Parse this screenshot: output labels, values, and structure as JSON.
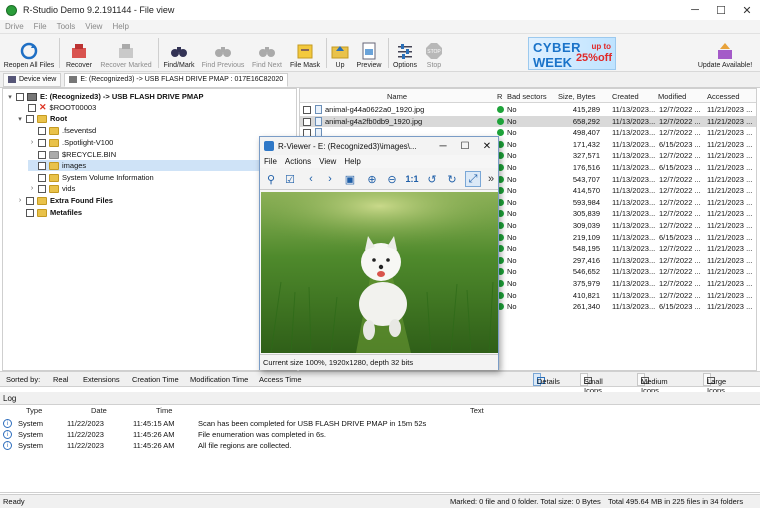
{
  "window": {
    "title": "R-Studio Demo 9.2.191144 - File view"
  },
  "menu": [
    "Drive",
    "File",
    "Tools",
    "View",
    "Help"
  ],
  "toolbar": {
    "reopen": "Reopen All Files",
    "recover": "Recover",
    "recover_marked": "Recover Marked",
    "find_mark": "Find/Mark",
    "find_previous": "Find Previous",
    "find_next": "Find Next",
    "file_mask": "File Mask",
    "up": "Up",
    "preview": "Preview",
    "options": "Options",
    "stop": "Stop",
    "update": "Update Available!"
  },
  "banner": {
    "line1": "CYBER",
    "line2": "WEEK",
    "up_to": "up to",
    "off": "25%off"
  },
  "tabs": {
    "device_view": "Device view",
    "path": "E: (Recognized3) -> USB FLASH DRIVE PMAP : 017E16C82020"
  },
  "tree": [
    {
      "label": "E: (Recognized3) -> USB FLASH DRIVE PMAP"
    },
    {
      "label": "$ROOT00003"
    },
    {
      "label": "Root"
    },
    {
      "label": ".fseventsd"
    },
    {
      "label": ".Spotlight-V100"
    },
    {
      "label": "$RECYCLE.BIN"
    },
    {
      "label": "images"
    },
    {
      "label": "System Volume Information"
    },
    {
      "label": "vids"
    },
    {
      "label": "Extra Found Files"
    },
    {
      "label": "Metafiles"
    }
  ],
  "file_headers": {
    "name": "Name",
    "r": "R",
    "bad": "Bad sectors",
    "size": "Size, Bytes",
    "created": "Created",
    "modified": "Modified",
    "accessed": "Accessed"
  },
  "files": [
    {
      "name": "animal-g44a0622a0_1920.jpg",
      "bad": "No",
      "size": "415,289",
      "created": "11/13/2023...",
      "modified": "12/7/2022 ...",
      "accessed": "11/21/2023 ..."
    },
    {
      "name": "animal-g4a2fb0db9_1920.jpg",
      "bad": "No",
      "size": "658,292",
      "created": "11/13/2023...",
      "modified": "12/7/2022 ...",
      "accessed": "11/21/2023 ..."
    },
    {
      "name": "",
      "bad": "No",
      "size": "498,407",
      "created": "11/13/2023...",
      "modified": "12/7/2022 ...",
      "accessed": "11/21/2023 ..."
    },
    {
      "name": "",
      "bad": "No",
      "size": "171,432",
      "created": "11/13/2023...",
      "modified": "6/15/2023 ...",
      "accessed": "11/21/2023 ..."
    },
    {
      "name": "",
      "bad": "No",
      "size": "327,571",
      "created": "11/13/2023...",
      "modified": "12/7/2022 ...",
      "accessed": "11/21/2023 ..."
    },
    {
      "name": "",
      "bad": "No",
      "size": "176,516",
      "created": "11/13/2023...",
      "modified": "6/15/2023 ...",
      "accessed": "11/21/2023 ..."
    },
    {
      "name": "",
      "bad": "No",
      "size": "543,707",
      "created": "11/13/2023...",
      "modified": "12/7/2022 ...",
      "accessed": "11/21/2023 ..."
    },
    {
      "name": "",
      "bad": "No",
      "size": "414,570",
      "created": "11/13/2023...",
      "modified": "12/7/2022 ...",
      "accessed": "11/21/2023 ..."
    },
    {
      "name": "",
      "bad": "No",
      "size": "593,984",
      "created": "11/13/2023...",
      "modified": "12/7/2022 ...",
      "accessed": "11/21/2023 ..."
    },
    {
      "name": "",
      "bad": "No",
      "size": "305,839",
      "created": "11/13/2023...",
      "modified": "12/7/2022 ...",
      "accessed": "11/21/2023 ..."
    },
    {
      "name": "",
      "bad": "No",
      "size": "309,039",
      "created": "11/13/2023...",
      "modified": "12/7/2022 ...",
      "accessed": "11/21/2023 ..."
    },
    {
      "name": "",
      "bad": "No",
      "size": "219,109",
      "created": "11/13/2023...",
      "modified": "6/15/2023 ...",
      "accessed": "11/21/2023 ..."
    },
    {
      "name": "",
      "bad": "No",
      "size": "548,195",
      "created": "11/13/2023...",
      "modified": "12/7/2022 ...",
      "accessed": "11/21/2023 ..."
    },
    {
      "name": "",
      "bad": "No",
      "size": "297,416",
      "created": "11/13/2023...",
      "modified": "12/7/2022 ...",
      "accessed": "11/21/2023 ..."
    },
    {
      "name": "",
      "bad": "No",
      "size": "546,652",
      "created": "11/13/2023...",
      "modified": "12/7/2022 ...",
      "accessed": "11/21/2023 ..."
    },
    {
      "name": "",
      "bad": "No",
      "size": "375,979",
      "created": "11/13/2023...",
      "modified": "12/7/2022 ...",
      "accessed": "11/21/2023 ..."
    },
    {
      "name": "",
      "bad": "No",
      "size": "410,821",
      "created": "11/13/2023...",
      "modified": "12/7/2022 ...",
      "accessed": "11/21/2023 ..."
    },
    {
      "name": "",
      "bad": "No",
      "size": "261,340",
      "created": "11/13/2023...",
      "modified": "6/15/2023 ...",
      "accessed": "11/21/2023 ..."
    }
  ],
  "sortbar": {
    "label": "Sorted by:",
    "items": [
      "Real",
      "Extensions",
      "Creation Time",
      "Modification Time",
      "Access Time"
    ]
  },
  "views": [
    "Details",
    "Small Icons",
    "Medium Icons",
    "Large Icons"
  ],
  "log": {
    "title": "Log",
    "headers": {
      "type": "Type",
      "date": "Date",
      "time": "Time",
      "text": "Text"
    },
    "rows": [
      {
        "type": "System",
        "date": "11/22/2023",
        "time": "11:45:15 AM",
        "text": "Scan has been completed for USB FLASH DRIVE PMAP in 15m 52s"
      },
      {
        "type": "System",
        "date": "11/22/2023",
        "time": "11:45:26 AM",
        "text": "File enumeration was completed in 6s."
      },
      {
        "type": "System",
        "date": "11/22/2023",
        "time": "11:45:26 AM",
        "text": "All file regions are collected."
      }
    ]
  },
  "status": {
    "left": "Ready",
    "marked": "Marked: 0 file and 0 folder. Total size: 0 Bytes",
    "total": "Total 495.64 MB in 225 files in 34 folders"
  },
  "viewer": {
    "title": "R-Viewer - E: (Recognized3)\\images\\...",
    "menu": [
      "File",
      "Actions",
      "View",
      "Help"
    ],
    "status": "Current size 100%, 1920x1280, depth 32 bits"
  }
}
